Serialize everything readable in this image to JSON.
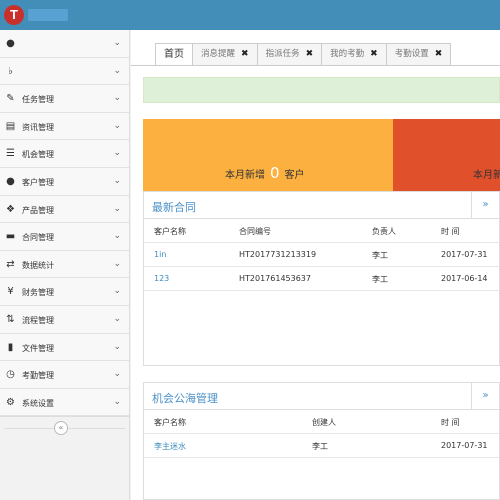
{
  "header": {
    "logo_letter": "T"
  },
  "sidebar": {
    "items": [
      {
        "icon": "user-icon",
        "label": ""
      },
      {
        "icon": "bell-icon",
        "label": ""
      },
      {
        "icon": "edit-icon",
        "label": "任务管理"
      },
      {
        "icon": "file-text-icon",
        "label": "资讯管理"
      },
      {
        "icon": "list-icon",
        "label": "机会管理"
      },
      {
        "icon": "users-icon",
        "label": "客户管理"
      },
      {
        "icon": "dropbox-icon",
        "label": "产品管理"
      },
      {
        "icon": "folder-open-icon",
        "label": "合同管理"
      },
      {
        "icon": "random-icon",
        "label": "数据统计"
      },
      {
        "icon": "yen-icon",
        "label": "财务管理"
      },
      {
        "icon": "retweet-icon",
        "label": "流程管理"
      },
      {
        "icon": "file-icon",
        "label": "文件管理"
      },
      {
        "icon": "clock-icon",
        "label": "考勤管理"
      },
      {
        "icon": "gear-icon",
        "label": "系统设置"
      }
    ]
  },
  "tabs": [
    {
      "label": "首页",
      "closable": false
    },
    {
      "label": "消息提醒",
      "closable": true
    },
    {
      "label": "指派任务",
      "closable": true
    },
    {
      "label": "我的考勤",
      "closable": true
    },
    {
      "label": "考勤设置",
      "closable": true
    }
  ],
  "stats": {
    "left_prefix": "本月新增",
    "left_value": "0",
    "left_suffix": "客户",
    "right_prefix": "本月新",
    "colors": {
      "orange": "#fcb040",
      "red": "#e0502b"
    }
  },
  "contracts": {
    "title": "最新合同",
    "more": "»",
    "headers": [
      "客户名称",
      "合同编号",
      "负责人",
      "时 间"
    ],
    "rows": [
      [
        "1in",
        "HT2017731213319",
        "李工",
        "2017-07-31"
      ],
      [
        "123",
        "HT201761453637",
        "李工",
        "2017-06-14"
      ]
    ]
  },
  "opportunities": {
    "title": "机会公海管理",
    "more": "»",
    "headers": [
      "客户名称",
      "创建人",
      "时 间"
    ],
    "rows": [
      [
        "李主迷水",
        "李工",
        "2017-07-31"
      ]
    ]
  }
}
